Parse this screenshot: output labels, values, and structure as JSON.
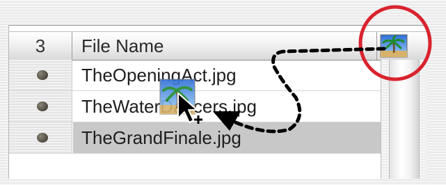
{
  "table": {
    "count_header": "3",
    "name_header": "File Name",
    "column_icon": "palm-tree-image-icon"
  },
  "rows": [
    {
      "name": "TheOpeningAct.jpg",
      "selected": false
    },
    {
      "name": "TheWaterDancers.jpg",
      "selected": false
    },
    {
      "name": "TheGrandFinale.jpg",
      "selected": true
    }
  ],
  "annotation": {
    "highlight_color": "#d9232e",
    "arrow_style": "dashed",
    "drag_icon": "palm-tree-image-icon",
    "cursor_icon": "arrow-cursor-with-plus-icon"
  }
}
